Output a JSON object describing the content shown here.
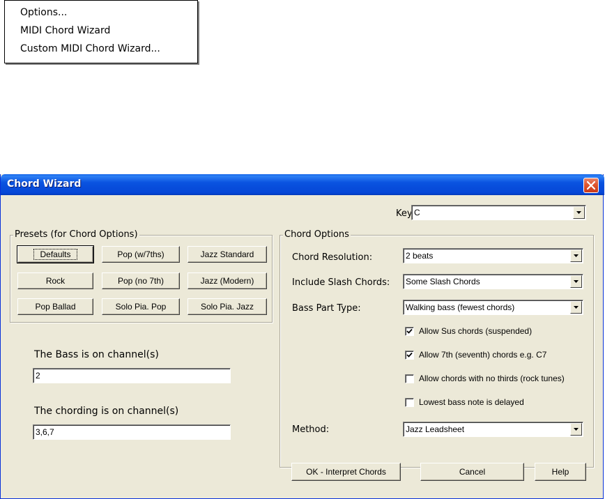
{
  "menu": {
    "items": [
      {
        "label": "Options..."
      },
      {
        "label": "MIDI Chord Wizard"
      },
      {
        "label": "Custom MIDI Chord Wizard..."
      }
    ]
  },
  "dialog": {
    "title": "Chord Wizard",
    "key": {
      "label": "Key:",
      "value": "C"
    },
    "presets": {
      "legend": "Presets  (for Chord Options)",
      "buttons": [
        {
          "label": "Defaults"
        },
        {
          "label": "Pop (w/7ths)"
        },
        {
          "label": "Jazz Standard"
        },
        {
          "label": "Rock"
        },
        {
          "label": "Pop (no 7th)"
        },
        {
          "label": "Jazz (Modern)"
        },
        {
          "label": "Pop Ballad"
        },
        {
          "label": "Solo Pia. Pop"
        },
        {
          "label": "Solo Pia. Jazz"
        }
      ]
    },
    "bass_channel": {
      "label": "The Bass is on channel(s)",
      "value": "2"
    },
    "chord_channel": {
      "label": "The chording is on channel(s)",
      "value": "3,6,7"
    },
    "chord_options": {
      "legend": "Chord Options",
      "resolution": {
        "label": "Chord Resolution:",
        "value": "2 beats"
      },
      "slash": {
        "label": "Include Slash Chords:",
        "value": "Some Slash Chords"
      },
      "bass_type": {
        "label": "Bass Part Type:",
        "value": "Walking bass (fewest chords)"
      },
      "checkboxes": [
        {
          "label": "Allow Sus chords (suspended)",
          "checked": true
        },
        {
          "label": "Allow 7th (seventh) chords e.g. C7",
          "checked": true
        },
        {
          "label": "Allow chords with no thirds (rock tunes)",
          "checked": false
        },
        {
          "label": "Lowest bass note is delayed",
          "checked": false
        }
      ],
      "method": {
        "label": "Method:",
        "value": "Jazz Leadsheet"
      }
    },
    "footer": {
      "ok": "OK - Interpret Chords",
      "cancel": "Cancel",
      "help": "Help"
    },
    "colors": {
      "titlebar": "#0a53e0",
      "face": "#ece9d8",
      "close": "#e0572f"
    }
  }
}
